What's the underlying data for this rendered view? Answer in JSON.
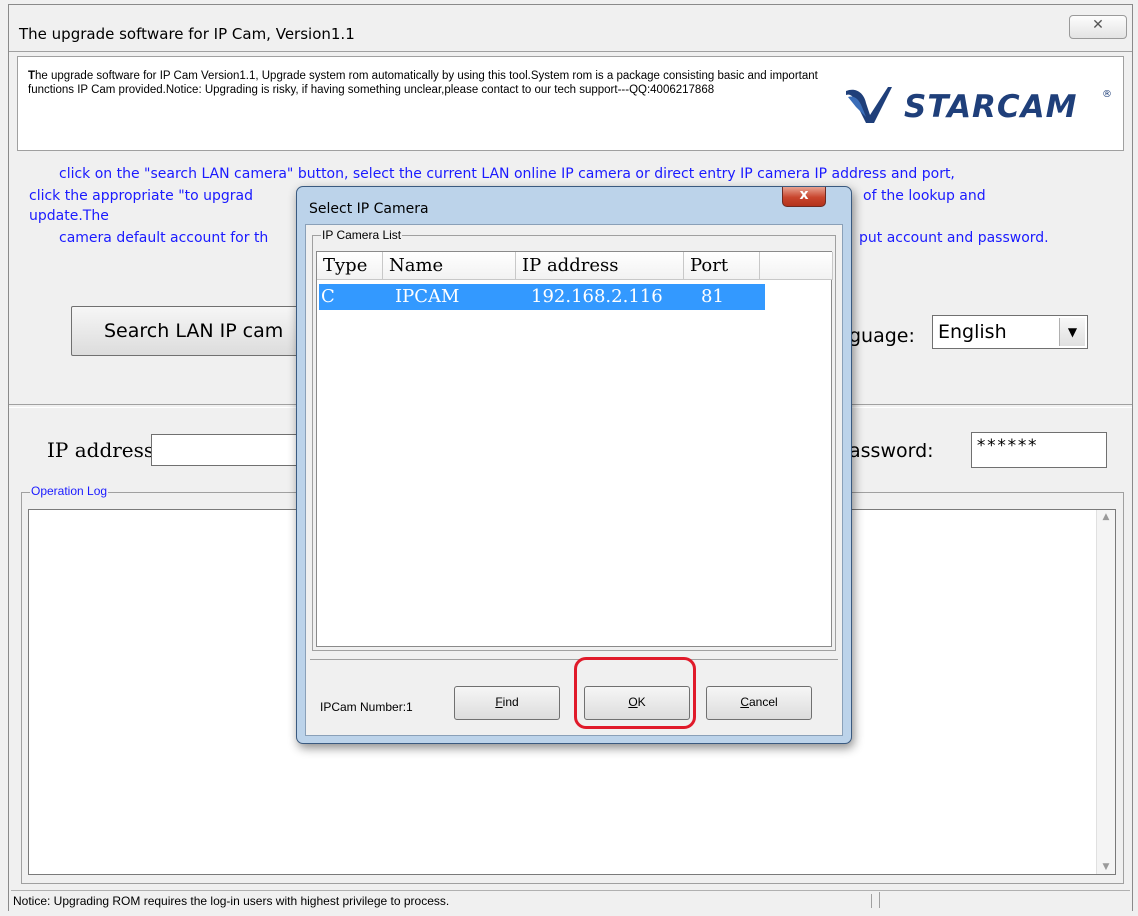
{
  "window": {
    "title": "The upgrade software for IP Cam, Version1.1",
    "close_glyph": "✕"
  },
  "header": {
    "description_lead": "T",
    "description_rest": "he upgrade software for IP Cam Version1.1, Upgrade system rom automatically by using this tool.System rom is a package consisting basic and important functions IP Cam provided.Notice: Upgrading is risky, if having something unclear,please contact to our tech support---QQ:4006217868",
    "logo_text": "STARCAM",
    "logo_mark": "®"
  },
  "instructions": {
    "line1": "click on the \"search LAN camera\" button, select the current LAN online IP camera or direct entry IP camera IP address and port,",
    "line2": "click the appropriate \"to upgrad",
    "line2_end": "of the lookup and",
    "line2b": "update.The",
    "line3": "camera default account for th",
    "line3_end": "put account and password."
  },
  "search_button": {
    "label": "Search LAN IP cam"
  },
  "language": {
    "label": "guage:",
    "value": "English"
  },
  "ip_address": {
    "label": "IP address",
    "value": ""
  },
  "password": {
    "label": "assword:",
    "value": "******"
  },
  "operation_log": {
    "legend": "Operation Log"
  },
  "status_bar": {
    "text": "Notice: Upgrading  ROM requires  the log-in users with highest privilege to process."
  },
  "dialog": {
    "title": "Select IP Camera",
    "group_legend": "IP Camera List",
    "columns": [
      "Type",
      "Name",
      "IP address",
      "Port"
    ],
    "rows": [
      {
        "type": "C",
        "name": "IPCAM",
        "ip": "192.168.2.116",
        "port": "81"
      }
    ],
    "count_label": "IPCam Number:1",
    "buttons": {
      "find_key": "F",
      "find_rest": "ind",
      "ok_key": "O",
      "ok_rest": "K",
      "cancel_key": "C",
      "cancel_rest": "ancel"
    }
  },
  "colors": {
    "instruction_text": "#1a1aff",
    "selection": "#3399ff",
    "highlight_ring": "#e01a2a"
  }
}
